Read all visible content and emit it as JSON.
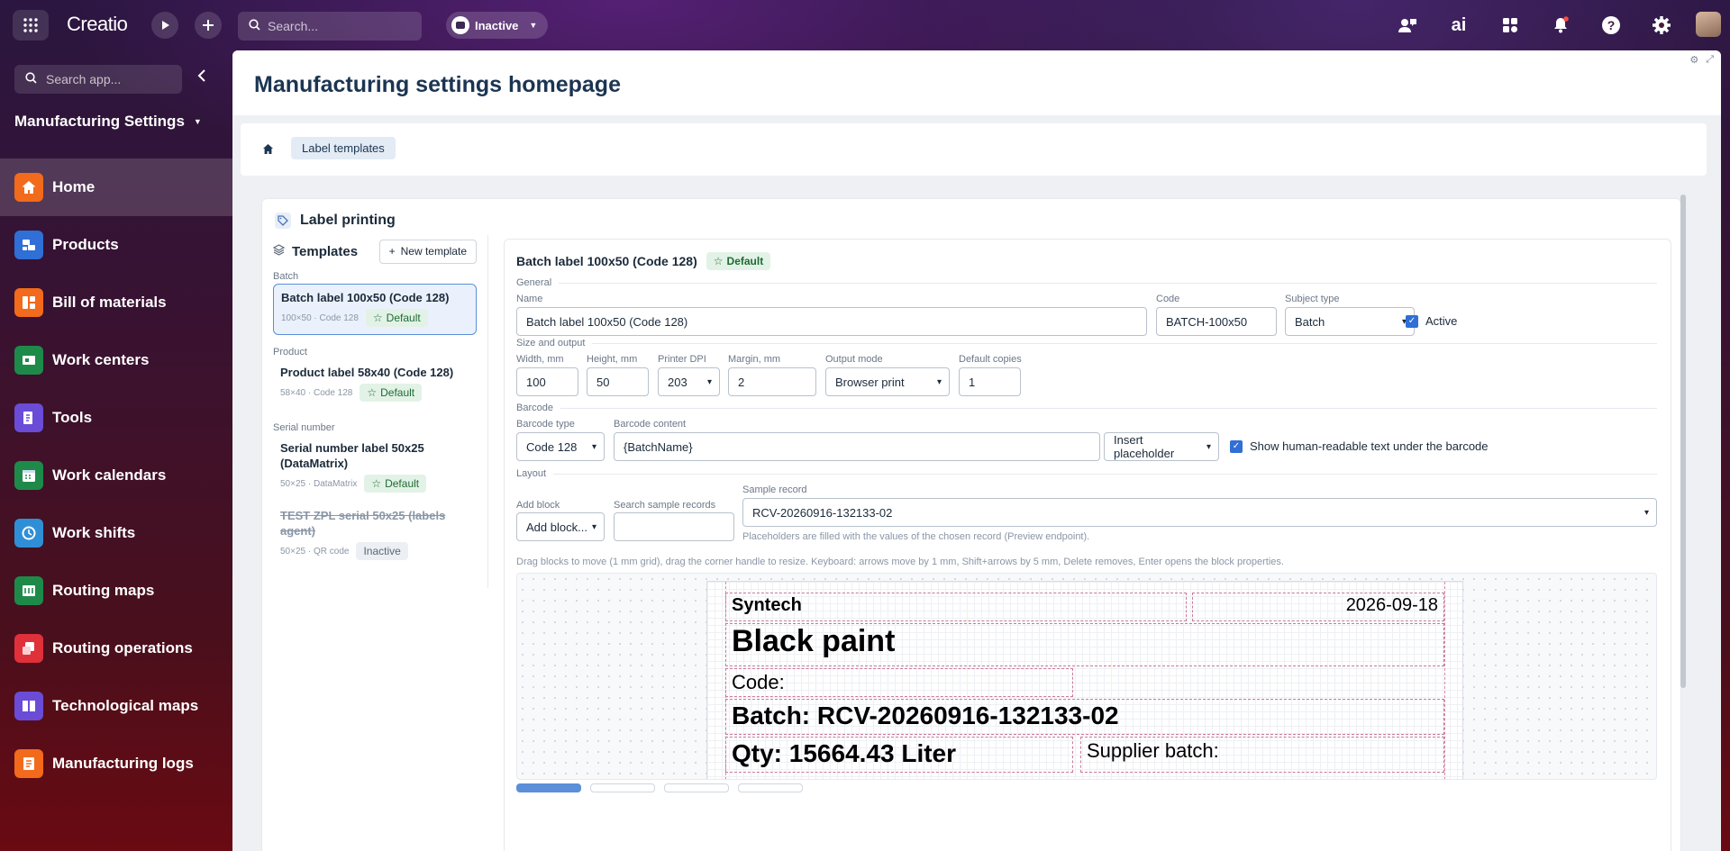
{
  "topbar": {
    "logo": "Creatio",
    "search_placeholder": "Search...",
    "status": "Inactive"
  },
  "sidebar": {
    "search_placeholder": "Search app...",
    "app_title": "Manufacturing Settings",
    "items": [
      {
        "label": "Home",
        "color": "#f26a1b"
      },
      {
        "label": "Products",
        "color": "#2f6fd6"
      },
      {
        "label": "Bill of materials",
        "color": "#f26a1b"
      },
      {
        "label": "Work centers",
        "color": "#1e8a4a"
      },
      {
        "label": "Tools",
        "color": "#6a4cd6"
      },
      {
        "label": "Work calendars",
        "color": "#1e8a4a"
      },
      {
        "label": "Work shifts",
        "color": "#2f8fd6"
      },
      {
        "label": "Routing maps",
        "color": "#1e8a4a"
      },
      {
        "label": "Routing operations",
        "color": "#e0303a"
      },
      {
        "label": "Technological maps",
        "color": "#6a4cd6"
      },
      {
        "label": "Manufacturing logs",
        "color": "#f26a1b"
      }
    ]
  },
  "page": {
    "title": "Manufacturing settings homepage",
    "breadcrumb": "Label templates"
  },
  "label_printing": {
    "title": "Label printing",
    "templates_title": "Templates",
    "new_template": "New template",
    "groups": [
      {
        "name": "Batch",
        "items": [
          {
            "name": "Batch label 100x50 (Code 128)",
            "meta": "100×50 · Code 128",
            "badge": "Default"
          }
        ]
      },
      {
        "name": "Product",
        "items": [
          {
            "name": "Product label 58x40 (Code 128)",
            "meta": "58×40 · Code 128",
            "badge": "Default"
          }
        ]
      },
      {
        "name": "Serial number",
        "items": [
          {
            "name": "Serial number label 50x25 (DataMatrix)",
            "meta": "50×25 · DataMatrix",
            "badge": "Default"
          },
          {
            "name": "TEST ZPL serial 50x25 (labels agent)",
            "meta": "50×25 · QR code",
            "badge": "Inactive"
          }
        ]
      }
    ]
  },
  "editor": {
    "title": "Batch label 100x50 (Code 128)",
    "badge": "Default",
    "general": "General",
    "name_label": "Name",
    "name_value": "Batch label 100x50 (Code 128)",
    "code_label": "Code",
    "code_value": "BATCH-100x50",
    "subject_label": "Subject type",
    "subject_value": "Batch",
    "active_label": "Active",
    "size_section": "Size and output",
    "width_label": "Width, mm",
    "width_value": "100",
    "height_label": "Height, mm",
    "height_value": "50",
    "dpi_label": "Printer DPI",
    "dpi_value": "203",
    "margin_label": "Margin, mm",
    "margin_value": "2",
    "output_label": "Output mode",
    "output_value": "Browser print",
    "copies_label": "Default copies",
    "copies_value": "1",
    "barcode_section": "Barcode",
    "barcode_type_label": "Barcode type",
    "barcode_type_value": "Code 128",
    "barcode_content_label": "Barcode content",
    "barcode_content_value": "{BatchName}",
    "insert_placeholder": "Insert placeholder",
    "human_readable": "Show human-readable text under the barcode",
    "layout_section": "Layout",
    "add_block_label": "Add block",
    "add_block_value": "Add block...",
    "search_sample_label": "Search sample records",
    "sample_record_label": "Sample record",
    "sample_record_value": "RCV-20260916-132133-02",
    "placeholder_hint": "Placeholders are filled with the values of the chosen record (Preview endpoint).",
    "drag_hint": "Drag blocks to move (1 mm grid), drag the corner handle to resize. Keyboard: arrows move by 1 mm, Shift+arrows by 5 mm, Delete removes, Enter opens the block properties."
  },
  "label_preview": {
    "company": "Syntech",
    "date": "2026-09-18",
    "product": "Black paint",
    "code": "Code:",
    "batch": "Batch: RCV-20260916-132133-02",
    "qty": "Qty: 15664.43 Liter",
    "supplier_batch": "Supplier batch:"
  }
}
